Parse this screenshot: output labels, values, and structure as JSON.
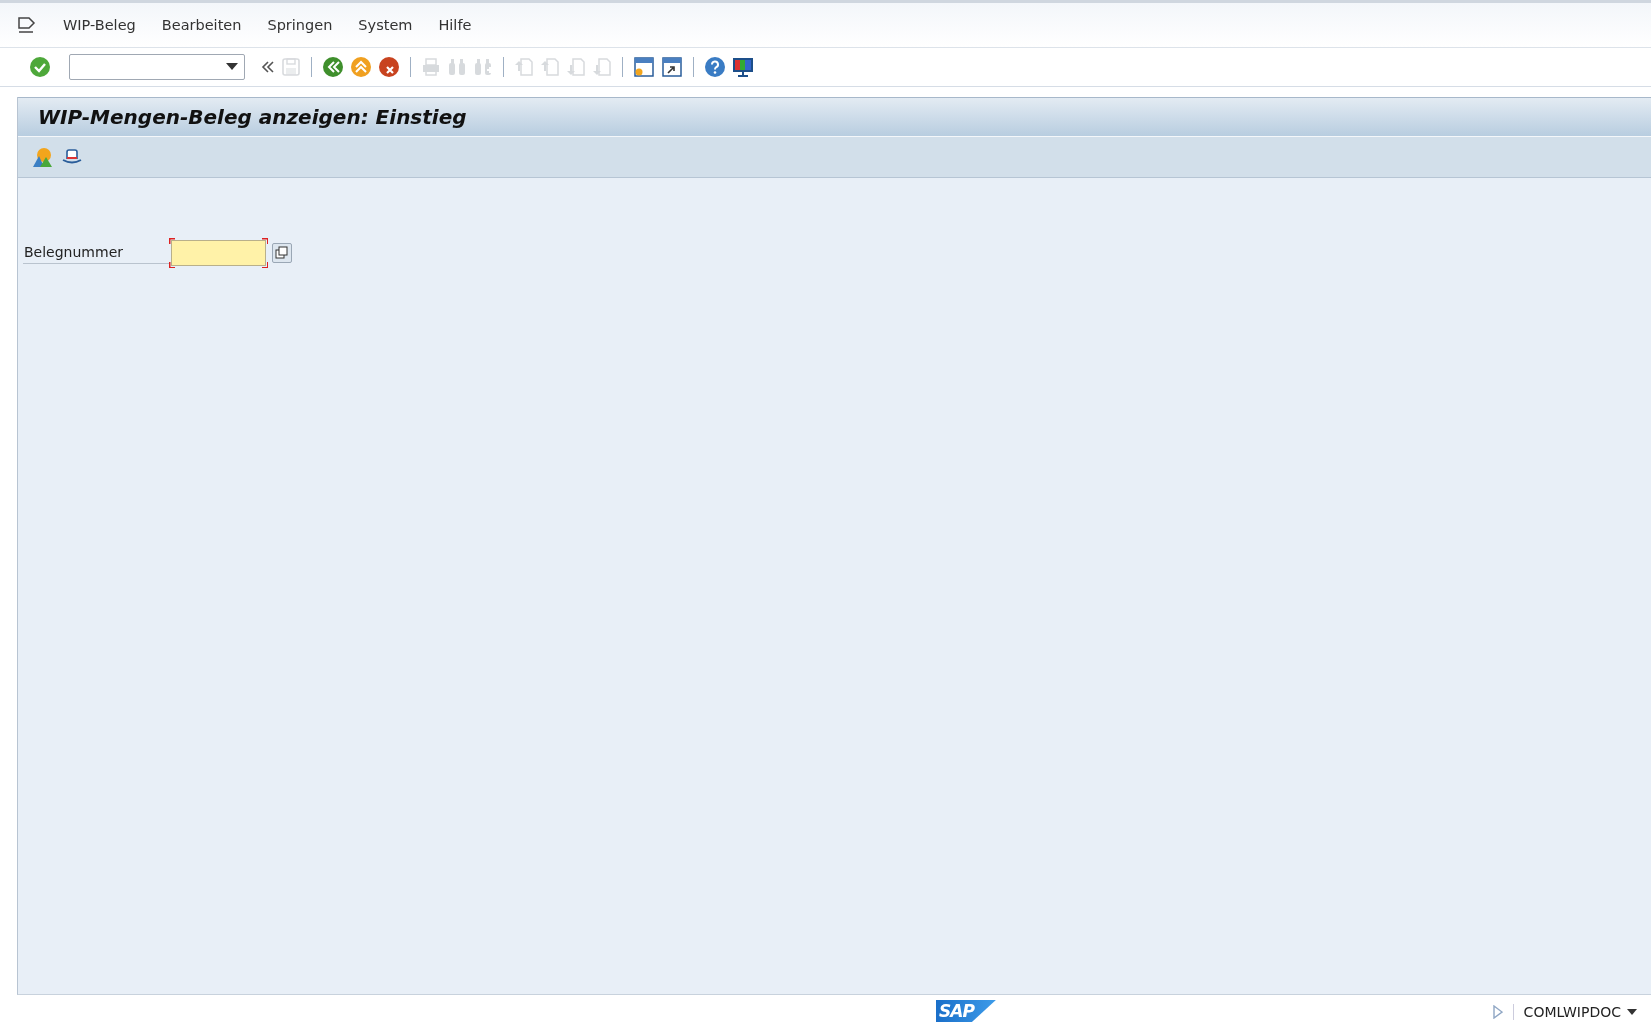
{
  "menu_bar": {
    "items": [
      {
        "label": "WIP-Beleg"
      },
      {
        "label": "Bearbeiten"
      },
      {
        "label": "Springen"
      },
      {
        "label": "System"
      },
      {
        "label": "Hilfe"
      }
    ]
  },
  "toolbar": {
    "items": [
      {
        "kind": "back-chevrons",
        "disabled": false
      },
      {
        "kind": "save",
        "disabled": true
      },
      {
        "kind": "separator"
      },
      {
        "kind": "back",
        "disabled": false
      },
      {
        "kind": "exit",
        "disabled": false
      },
      {
        "kind": "cancel",
        "disabled": false
      },
      {
        "kind": "separator"
      },
      {
        "kind": "print",
        "disabled": true
      },
      {
        "kind": "find",
        "disabled": true
      },
      {
        "kind": "find-next",
        "disabled": true
      },
      {
        "kind": "separator"
      },
      {
        "kind": "first-page",
        "disabled": true
      },
      {
        "kind": "prev-page",
        "disabled": true
      },
      {
        "kind": "next-page",
        "disabled": true
      },
      {
        "kind": "last-page",
        "disabled": true
      },
      {
        "kind": "separator"
      },
      {
        "kind": "new-session",
        "disabled": false
      },
      {
        "kind": "shortcut",
        "disabled": false
      },
      {
        "kind": "separator"
      },
      {
        "kind": "help",
        "disabled": false
      },
      {
        "kind": "layout",
        "disabled": false
      }
    ]
  },
  "screen": {
    "title": "WIP-Mengen-Beleg anzeigen: Einstieg",
    "app_toolbar": [
      {
        "kind": "mountains"
      },
      {
        "kind": "hat"
      }
    ],
    "fields": [
      {
        "label": "Belegnummer",
        "required": true
      }
    ]
  },
  "status_bar": {
    "logo": "SAP",
    "transaction": "COMLWIPDOC"
  }
}
